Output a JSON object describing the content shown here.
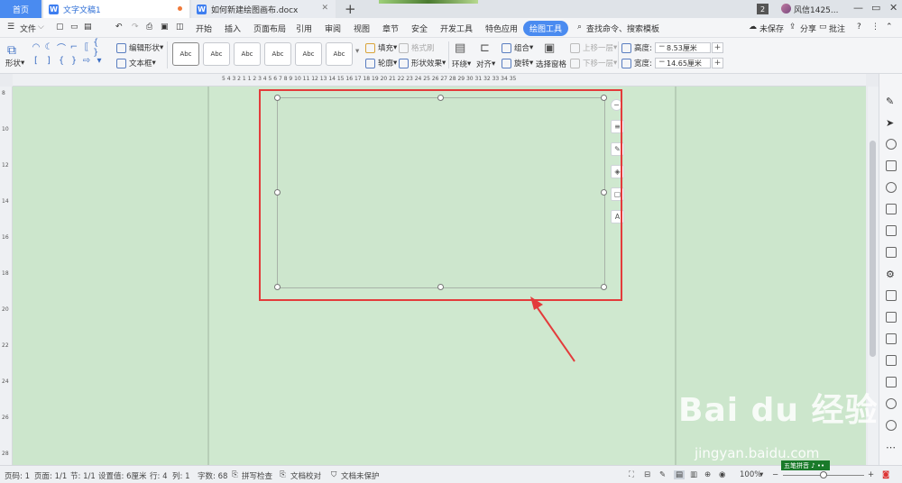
{
  "titlebar": {
    "home_tab": "首页",
    "tabs": [
      {
        "label": "文字文稿1",
        "active": true
      },
      {
        "label": "如何新建绘图画布.docx",
        "active": false
      }
    ],
    "window_count": "2",
    "user_name": "风信1425...",
    "controls": [
      "—",
      "▭",
      "✕"
    ]
  },
  "menubar": {
    "file": "文件",
    "items": [
      "开始",
      "插入",
      "页面布局",
      "引用",
      "审阅",
      "视图",
      "章节",
      "安全",
      "开发工具",
      "特色应用",
      "绘图工具"
    ],
    "active": "绘图工具",
    "search": "查找命令、搜索模板",
    "right": {
      "save_status": "未保存",
      "share": "分享",
      "comment": "批注"
    }
  },
  "ribbon": {
    "shape_label": "形状",
    "edit_shape": "编辑形状",
    "text_box": "文本框",
    "style_samples": [
      "Abc",
      "Abc",
      "Abc",
      "Abc",
      "Abc",
      "Abc"
    ],
    "fill": "填充",
    "format_brush": "格式刷",
    "outline": "轮廓",
    "shape_effect": "形状效果",
    "wrap": "环绕",
    "align": "对齐",
    "group": "组合",
    "rotate": "旋转",
    "selection_pane": "选择窗格",
    "bring_forward": "上移一层",
    "send_backward": "下移一层",
    "height_label": "高度:",
    "height_value": "8.53厘米",
    "width_label": "宽度:",
    "width_value": "14.65厘米"
  },
  "ruler": {
    "top_numbers": "5   4   3   2   1        1   2   3   4   5   6   7   8   9  10  11  12  13  14  15  16  17  18  19  20  21  22  23  24  25  26  27  28  29  30  31  32  33  34  35"
  },
  "watermark": {
    "main": "Bai du 经验",
    "sub": "jingyan.baidu.com"
  },
  "ime": "五笔拼音 ♪ •• ",
  "statusbar": {
    "page_num": "页码: 1",
    "page": "页面: 1/1",
    "section": "节: 1/1",
    "set_value": "设置值: 6厘米",
    "row": "行: 4",
    "col": "列: 1",
    "word_count": "字数: 68",
    "spell_check": "拼写检查",
    "doc_check": "文档校对",
    "protect": "文档未保护",
    "zoom": "100%"
  }
}
